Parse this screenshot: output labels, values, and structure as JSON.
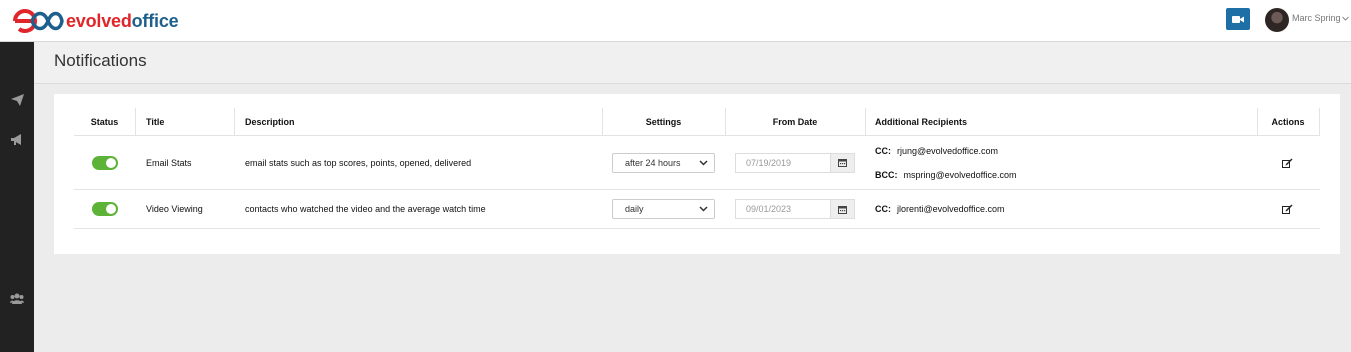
{
  "app": {
    "logo_evolved": "evolved",
    "logo_office": "office",
    "user_name": "Marc Spring"
  },
  "icons": {
    "video": "video-camera-icon",
    "send": "paper-plane-icon",
    "campaigns": "megaphone-icon",
    "contacts": "users-icon",
    "calendar": "calendar-icon",
    "edit": "edit-icon",
    "dropdown": "chevron-down-icon"
  },
  "colors": {
    "accent_blue": "#1e6fa6",
    "toggle_on": "#5cb338",
    "logo_red": "#e0262b",
    "logo_blue": "#1e5f8c",
    "sidebar": "#222222"
  },
  "page": {
    "title": "Notifications"
  },
  "table": {
    "headers": {
      "status": "Status",
      "title": "Title",
      "description": "Description",
      "settings": "Settings",
      "from_date": "From Date",
      "recipients": "Additional Recipients",
      "actions": "Actions"
    },
    "rows": [
      {
        "status_on": true,
        "title": "Email Stats",
        "description": "email stats such as top scores, points, opened, delivered",
        "setting": "after 24 hours",
        "from_date": "07/19/2019",
        "cc_label": "CC:",
        "cc": "rjung@evolvedoffice.com",
        "bcc_label": "BCC:",
        "bcc": "mspring@evolvedoffice.com"
      },
      {
        "status_on": true,
        "title": "Video Viewing",
        "description": "contacts who watched the video and the average watch time",
        "setting": "daily",
        "from_date": "09/01/2023",
        "cc_label": "CC:",
        "cc": "jlorenti@evolvedoffice.com"
      }
    ]
  }
}
